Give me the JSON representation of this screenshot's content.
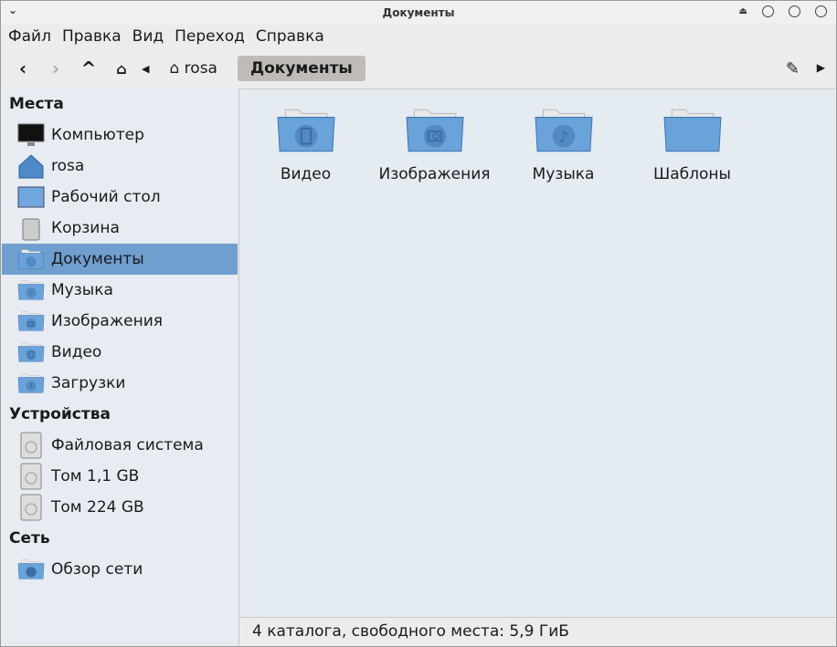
{
  "window": {
    "title": "Документы"
  },
  "menu": [
    "Файл",
    "Правка",
    "Вид",
    "Переход",
    "Справка"
  ],
  "breadcrumb": {
    "home": "rosa",
    "current": "Документы"
  },
  "sidebar": {
    "places_header": "Места",
    "places": [
      {
        "label": "Компьютер",
        "icon": "computer-icon"
      },
      {
        "label": "rosa",
        "icon": "home-icon"
      },
      {
        "label": "Рабочий стол",
        "icon": "desktop-icon"
      },
      {
        "label": "Корзина",
        "icon": "trash-icon"
      },
      {
        "label": "Документы",
        "icon": "folder-documents-icon"
      },
      {
        "label": "Музыка",
        "icon": "folder-music-icon"
      },
      {
        "label": "Изображения",
        "icon": "folder-pictures-icon"
      },
      {
        "label": "Видео",
        "icon": "folder-video-icon"
      },
      {
        "label": "Загрузки",
        "icon": "folder-downloads-icon"
      }
    ],
    "devices_header": "Устройства",
    "devices": [
      {
        "label": "Файловая система"
      },
      {
        "label": "Том 1,1 GB"
      },
      {
        "label": "Том 224 GB"
      }
    ],
    "network_header": "Сеть",
    "network": [
      {
        "label": "Обзор сети"
      }
    ]
  },
  "files": [
    {
      "label": "Видео",
      "emblem": "film"
    },
    {
      "label": "Изображения",
      "emblem": "camera"
    },
    {
      "label": "Музыка",
      "emblem": "note"
    },
    {
      "label": "Шаблоны",
      "emblem": ""
    }
  ],
  "status": "4 каталога, свободного места: 5,9 ГиБ",
  "colors": {
    "selection": "#6e9fcf",
    "folder": "#5b93cc"
  }
}
